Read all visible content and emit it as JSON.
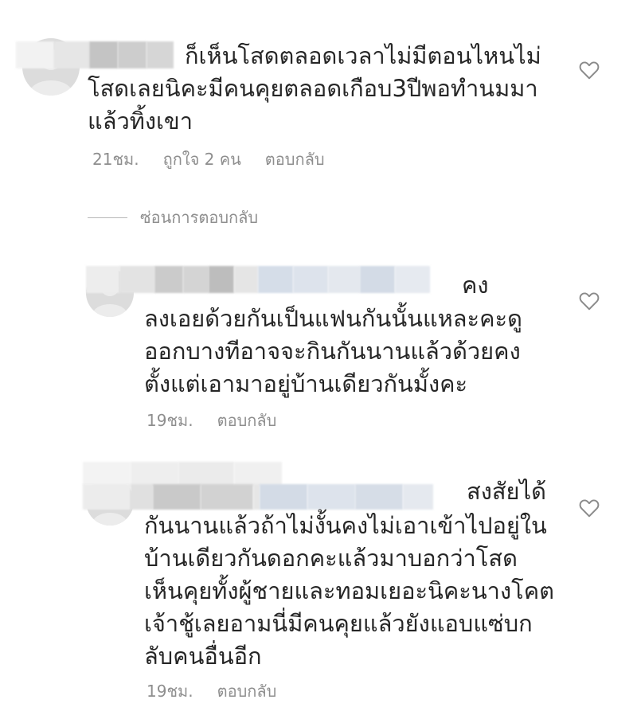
{
  "comments": [
    {
      "text": "ก็เห็นโสดตลอดเวลาไม่มีตอนไหนไม่",
      "lines": [
        "โสดเลยนิคะมีคนคุยตลอดเกือบ3ปีพอทำนมมา",
        "แล้วทิ้งเขา"
      ],
      "time": "21ชม.",
      "likes": "ถูกใจ 2 คน",
      "reply": "ตอบกลับ"
    },
    {
      "first_line_tail": "คง",
      "lines": [
        "ลงเอยด้วยกันเป็นแฟนกันนั้นแหละคะดู",
        "ออกบางทีอาจจะกินกันนานแล้วด้วยคง",
        "ตั้งแต่เอามาอยู่บ้านเดียวกันมั้งคะ"
      ],
      "time": "19ชม.",
      "reply": "ตอบกลับ"
    },
    {
      "first_line_tail": "สงสัยได้",
      "lines": [
        "กันนานแล้วถ้าไม่งั้นคงไม่เอาเข้าไปอยู่ใน",
        "บ้านเดียวกันดอกคะแล้วมาบอกว่าโสด",
        "เห็นคุยทั้งผู้ชายและทอมเยอะนิคะนางโคต",
        "เจ้าชู้เลยอามนี่มีคนคุยแล้วยังแอบแซ่บก",
        "ลับคนอื่นอีก"
      ],
      "time": "19ชม.",
      "reply": "ตอบกลับ"
    }
  ],
  "hide_replies_label": "ซ่อนการตอบกลับ",
  "icons": {
    "like": "heart-outline-icon",
    "avatar": "default-avatar-icon"
  },
  "colors": {
    "text": "#262626",
    "meta": "#8e8e8e",
    "avatar": "#dcdcdc"
  }
}
